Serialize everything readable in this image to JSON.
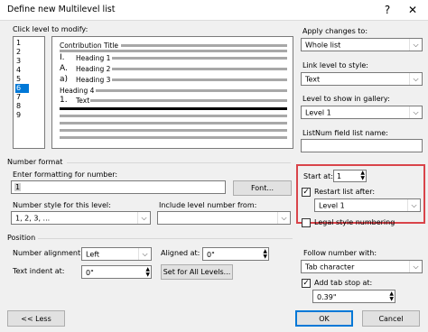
{
  "window": {
    "title": "Define new Multilevel list",
    "help": "?",
    "close": "✕"
  },
  "level_list": {
    "label": "Click level to modify:",
    "items": [
      "1",
      "2",
      "3",
      "4",
      "5",
      "6",
      "7",
      "8",
      "9"
    ],
    "selected_index": 5
  },
  "preview": {
    "lines": [
      {
        "prefix": "",
        "text": "Contribution Title"
      },
      {
        "prefix": "I.",
        "text": "Heading 1"
      },
      {
        "prefix": "A.",
        "text": "Heading 2"
      },
      {
        "prefix": "a)",
        "text": "Heading 3"
      },
      {
        "prefix": "",
        "text": "Heading 4"
      },
      {
        "prefix": "1.",
        "text": "Text"
      }
    ]
  },
  "right_panel": {
    "apply_changes_label": "Apply changes to:",
    "apply_changes_value": "Whole list",
    "link_level_label": "Link level to style:",
    "link_level_value": "Text",
    "level_show_label": "Level to show in gallery:",
    "level_show_value": "Level 1",
    "listnum_label": "ListNum field list name:",
    "listnum_value": ""
  },
  "number_format": {
    "section": "Number format",
    "enter_formatting_label": "Enter formatting for number:",
    "formatting_value": "1",
    "font_button": "Font...",
    "number_style_label": "Number style for this level:",
    "number_style_value": "1, 2, 3, ...",
    "include_level_label": "Include level number from:",
    "include_level_value": "",
    "start_at_label": "Start at:",
    "start_at_value": "1",
    "restart_label": "Restart list after:",
    "restart_checked": true,
    "restart_value": "Level 1",
    "legal_label": "Legal style numbering",
    "legal_checked": false
  },
  "position": {
    "section": "Position",
    "number_alignment_label": "Number alignment:",
    "number_alignment_value": "Left",
    "aligned_at_label": "Aligned at:",
    "aligned_at_value": "0\"",
    "text_indent_label": "Text indent at:",
    "text_indent_value": "0\"",
    "set_all_button": "Set for All Levels...",
    "follow_number_label": "Follow number with:",
    "follow_number_value": "Tab character",
    "add_tab_label": "Add tab stop at:",
    "add_tab_checked": true,
    "add_tab_value": "0.39\""
  },
  "footer": {
    "less_button": "<< Less",
    "ok_button": "OK",
    "cancel_button": "Cancel"
  },
  "colors": {
    "accent": "#0078d7",
    "highlight": "#d9444a"
  }
}
